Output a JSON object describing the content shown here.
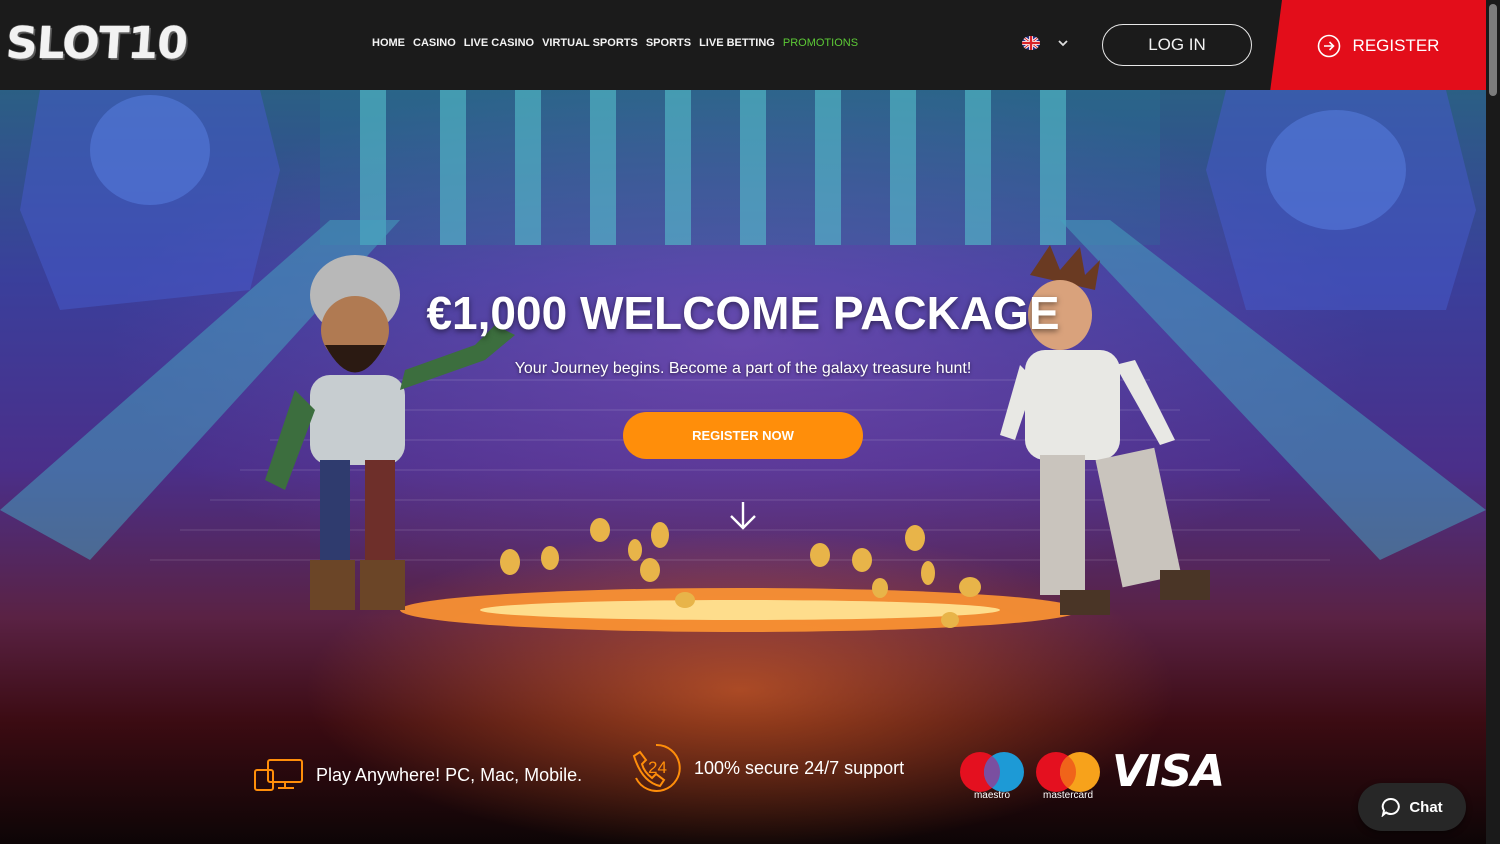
{
  "brand": {
    "logo_text": "SLOT10"
  },
  "nav": {
    "items": [
      {
        "label": "HOME"
      },
      {
        "label": "CASINO"
      },
      {
        "label": "LIVE CASINO"
      },
      {
        "label": "VIRTUAL SPORTS"
      },
      {
        "label": "SPORTS"
      },
      {
        "label": "LIVE BETTING"
      },
      {
        "label": "PROMOTIONS"
      }
    ],
    "active_color": "#5cc936"
  },
  "header": {
    "language_icon": "uk-flag-icon",
    "login_label": "LOG IN",
    "register_label": "REGISTER",
    "register_color": "#e30d1a"
  },
  "hero": {
    "title": "€1,000 WELCOME PACKAGE",
    "subtitle": "Your Journey begins. Become a part of the galaxy treasure hunt!",
    "cta_label": "REGISTER NOW",
    "cta_color": "#ff8e0a"
  },
  "features": [
    {
      "icon": "devices-icon",
      "text": "Play Anywhere! PC, Mac, Mobile."
    },
    {
      "icon": "support-24-icon",
      "text": "100% secure 24/7 support"
    }
  ],
  "payments": {
    "maestro_label": "maestro",
    "mastercard_label": "mastercard",
    "visa_label": "VISA"
  },
  "chat": {
    "label": "Chat"
  }
}
